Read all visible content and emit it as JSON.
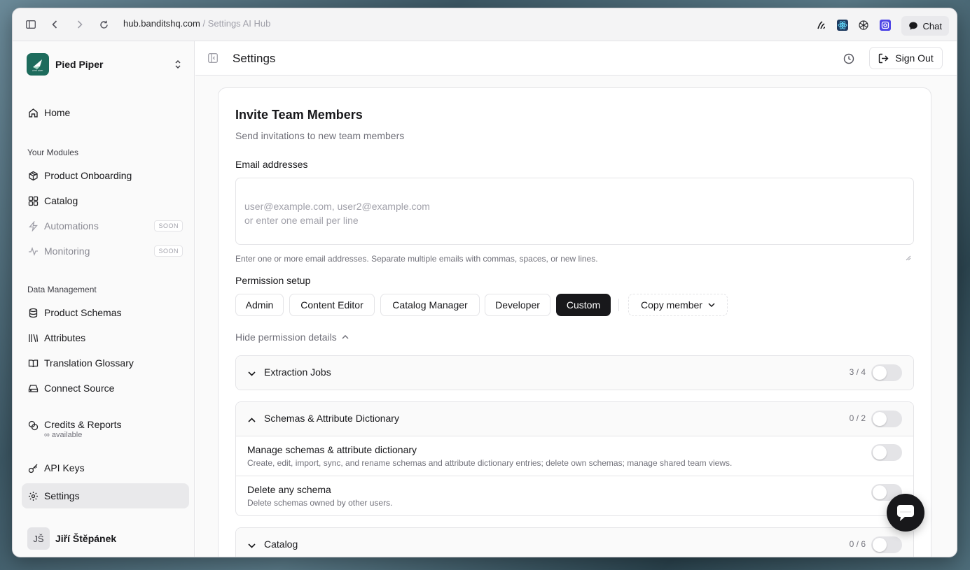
{
  "browser": {
    "url_host": "hub.banditshq.com",
    "url_sep": " / ",
    "url_page": "Settings AI Hub",
    "chat_label": "Chat"
  },
  "sidebar": {
    "org_name": "Pied Piper",
    "org_logo_text": "pied piper",
    "home": "Home",
    "modules_label": "Your Modules",
    "modules": [
      {
        "label": "Product Onboarding",
        "icon": "package-icon"
      },
      {
        "label": "Catalog",
        "icon": "grid-icon"
      },
      {
        "label": "Automations",
        "icon": "zap-icon",
        "badge": "SOON"
      },
      {
        "label": "Monitoring",
        "icon": "activity-icon",
        "badge": "SOON"
      }
    ],
    "data_label": "Data Management",
    "data_items": [
      {
        "label": "Product Schemas",
        "icon": "database-icon"
      },
      {
        "label": "Attributes",
        "icon": "library-icon"
      },
      {
        "label": "Translation Glossary",
        "icon": "book-icon"
      },
      {
        "label": "Connect Source",
        "icon": "hard-drive-icon"
      }
    ],
    "credits_label": "Credits & Reports",
    "credits_sub": "∞ available",
    "api_keys": "API Keys",
    "settings": "Settings",
    "user_initials": "JŠ",
    "user_name": "Jiří Štěpánek"
  },
  "topbar": {
    "title": "Settings",
    "sign_out": "Sign Out"
  },
  "invite": {
    "title": "Invite Team Members",
    "subtitle": "Send invitations to new team members",
    "email_label": "Email addresses",
    "email_placeholder": "user@example.com, user2@example.com\nor enter one email per line",
    "email_hint": "Enter one or more email addresses. Separate multiple emails with commas, spaces, or new lines.",
    "permission_label": "Permission setup",
    "roles": [
      "Admin",
      "Content Editor",
      "Catalog Manager",
      "Developer",
      "Custom"
    ],
    "selected_role": "Custom",
    "copy_member": "Copy member",
    "hide_details": "Hide permission details"
  },
  "groups": [
    {
      "title": "Extraction Jobs",
      "count": "3 / 4",
      "expanded": false
    },
    {
      "title": "Schemas & Attribute Dictionary",
      "count": "0 / 2",
      "expanded": true,
      "rows": [
        {
          "title": "Manage schemas & attribute dictionary",
          "desc": "Create, edit, import, sync, and rename schemas and attribute dictionary entries; delete own schemas; manage shared team views."
        },
        {
          "title": "Delete any schema",
          "desc": "Delete schemas owned by other users."
        }
      ]
    },
    {
      "title": "Catalog",
      "count": "0 / 6",
      "expanded": false
    }
  ],
  "colors": {
    "accent": "#18181b",
    "brand": "#1d6b5c",
    "toggle_off": "#e4e4e7"
  }
}
